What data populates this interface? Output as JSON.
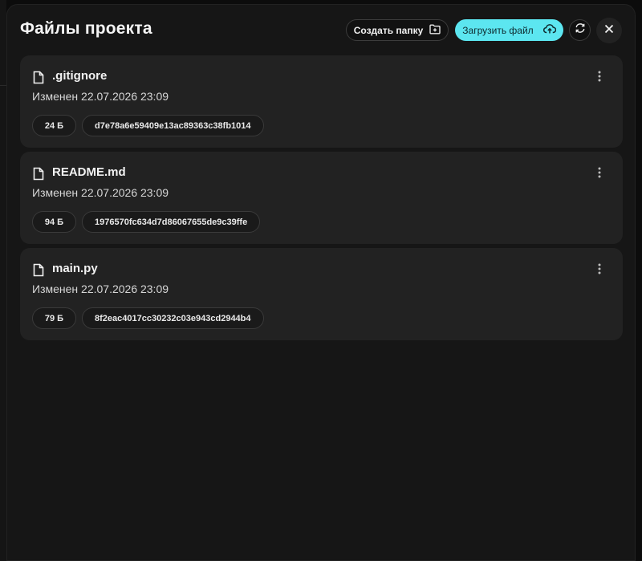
{
  "header": {
    "title": "Файлы проекта",
    "create_folder_label": "Создать папку",
    "upload_file_label": "Загрузить файл"
  },
  "colors": {
    "accent": "#5ce6f0",
    "background": "#161616",
    "card": "#222222"
  },
  "icons": {
    "create_folder": "folder-plus-icon",
    "upload": "cloud-upload-icon",
    "refresh": "refresh-icon",
    "close": "close-icon",
    "file": "file-icon",
    "more": "more-vertical-icon"
  },
  "files": [
    {
      "name": ".gitignore",
      "modified": "Изменен 22.07.2026 23:09",
      "size": "24 Б",
      "hash": "d7e78a6e59409e13ac89363c38fb1014"
    },
    {
      "name": "README.md",
      "modified": "Изменен 22.07.2026 23:09",
      "size": "94 Б",
      "hash": "1976570fc634d7d86067655de9c39ffe"
    },
    {
      "name": "main.py",
      "modified": "Изменен 22.07.2026 23:09",
      "size": "79 Б",
      "hash": "8f2eac4017cc30232c03e943cd2944b4"
    }
  ]
}
